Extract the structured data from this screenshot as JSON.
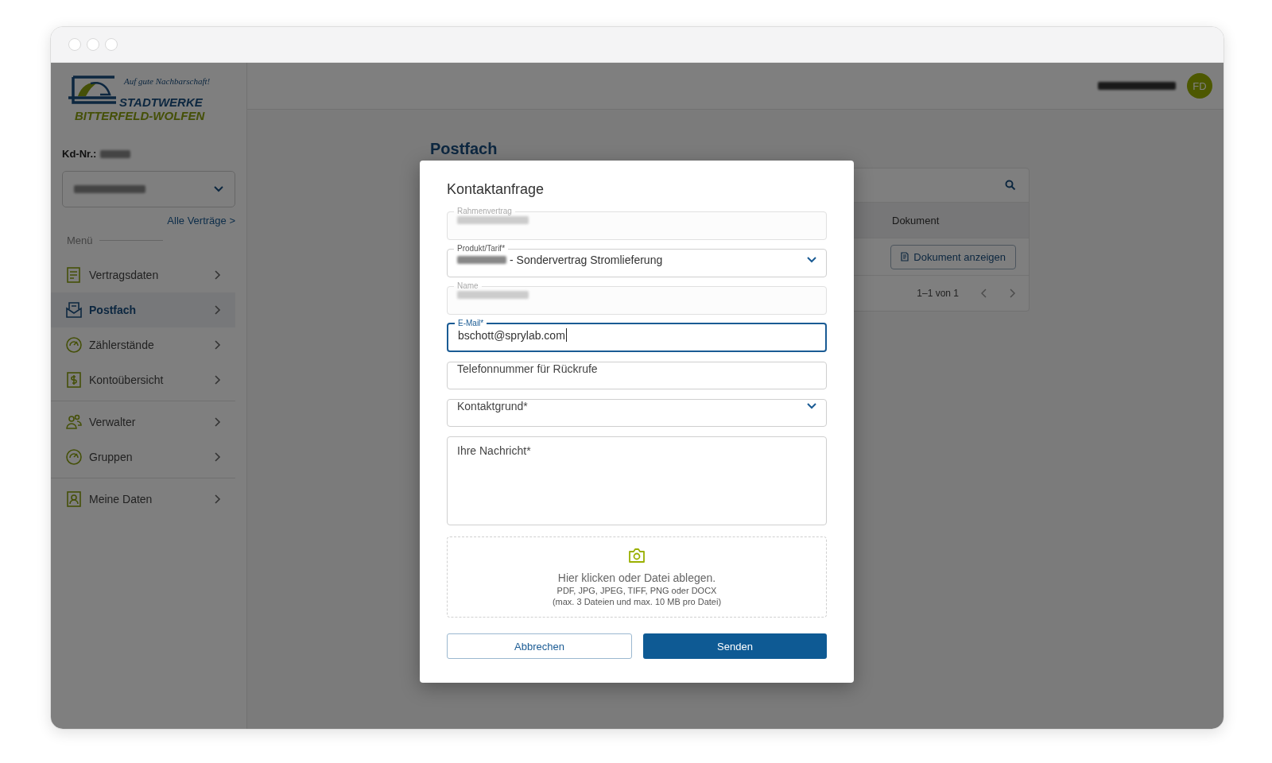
{
  "logo": {
    "tagline": "Auf gute Nachbarschaft!",
    "line1": "STADTWERKE",
    "line2": "BITTERFELD-WOLFEN"
  },
  "sidebar": {
    "customer": {
      "label": "Kd-Nr.:",
      "redacted": true
    },
    "contract_select": {
      "redacted": true
    },
    "all_contracts_link": "Alle Verträge >",
    "menu_heading": "Menü",
    "sections": [
      {
        "items": [
          {
            "label": "Vertragsdaten",
            "kind": "document",
            "selected": false
          },
          {
            "label": "Postfach",
            "kind": "mail",
            "selected": true
          },
          {
            "label": "Zählerstände",
            "kind": "gauge",
            "selected": false
          },
          {
            "label": "Kontoübersicht",
            "kind": "money",
            "selected": false
          }
        ]
      },
      {
        "items": [
          {
            "label": "Verwalter",
            "kind": "people",
            "selected": false
          },
          {
            "label": "Gruppen",
            "kind": "gauge",
            "selected": false
          }
        ]
      },
      {
        "items": [
          {
            "label": "Meine Daten",
            "kind": "person",
            "selected": false
          }
        ]
      }
    ]
  },
  "header": {
    "user": {
      "redacted": true,
      "initials": "FD"
    }
  },
  "page": {
    "title": "Postfach",
    "table": {
      "columns": [
        "Dokument"
      ],
      "rows": [
        {
          "action": "Dokument anzeigen"
        }
      ],
      "pagination": "1–1 von 1"
    }
  },
  "dialog": {
    "title": "Kontaktanfrage",
    "fields": [
      {
        "kind": "text",
        "label": "Rahmenvertrag",
        "redacted": true,
        "disabled": true,
        "focused": false
      },
      {
        "kind": "select",
        "label": "Produkt/Tarif*",
        "redacted": true,
        "value": "- Sondervertrag Stromlieferung",
        "disabled": false,
        "focused": false
      },
      {
        "kind": "text",
        "label": "Name",
        "redacted": true,
        "disabled": true,
        "focused": false
      },
      {
        "kind": "text",
        "label": "E-Mail*",
        "value": "bschott@sprylab.com",
        "disabled": false,
        "focused": true
      },
      {
        "kind": "text",
        "placeholder": "Telefonnummer für Rückrufe",
        "disabled": false,
        "focused": false
      },
      {
        "kind": "select",
        "placeholder": "Kontaktgrund*",
        "disabled": false,
        "focused": false
      },
      {
        "kind": "textarea",
        "placeholder": "Ihre Nachricht*",
        "disabled": false,
        "focused": false
      }
    ],
    "upload": {
      "title": "Hier klicken oder Datei ablegen.",
      "formats": "PDF, JPG, JPEG, TIFF, PNG oder DOCX",
      "limits": "(max. 3 Dateien und max. 10 MB pro Datei)"
    },
    "buttons": [
      {
        "label": "Abbrechen",
        "kind": "secondary"
      },
      {
        "label": "Senden",
        "kind": "primary"
      }
    ]
  }
}
